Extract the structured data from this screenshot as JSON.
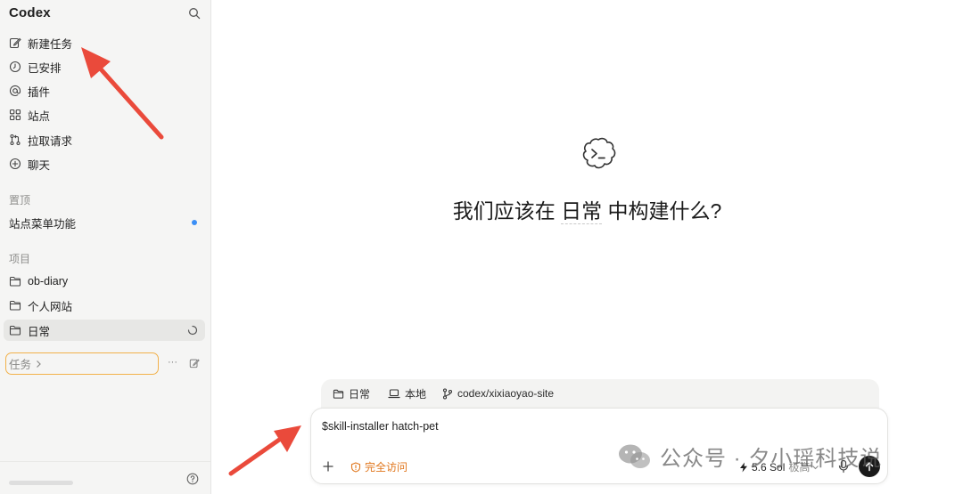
{
  "sidebar": {
    "app_title": "Codex",
    "nav": [
      {
        "label": "新建任务",
        "icon": "edit-icon"
      },
      {
        "label": "已安排",
        "icon": "clock-icon"
      },
      {
        "label": "插件",
        "icon": "at-icon"
      },
      {
        "label": "站点",
        "icon": "grid-icon"
      },
      {
        "label": "拉取请求",
        "icon": "pull-request-icon"
      },
      {
        "label": "聊天",
        "icon": "plus-circle-icon"
      }
    ],
    "pinned_section": "置顶",
    "pinned_item": "站点菜单功能",
    "projects_section": "项目",
    "projects": [
      "ob-diary",
      "个人网站",
      "日常"
    ],
    "tasks_label": "任务",
    "tasks_more": "···"
  },
  "main": {
    "headline_pre": "我们应该在 ",
    "headline_project": "日常",
    "headline_post": " 中构建什么?",
    "context": {
      "project": "日常",
      "location": "本地",
      "branch": "codex/xixiaoyao-site"
    },
    "composer": {
      "prompt": "$skill-installer hatch-pet",
      "access": "完全访问",
      "model": "5.6 Sol",
      "effort": "极高"
    }
  },
  "watermark": {
    "text": "公众号 · 夕小瑶科技说"
  },
  "colors": {
    "accent_orange": "#e0761c",
    "task_box_border": "#f2b14a",
    "pin_dot": "#3b8ff6",
    "annotation_arrow": "#ea4a3b"
  }
}
